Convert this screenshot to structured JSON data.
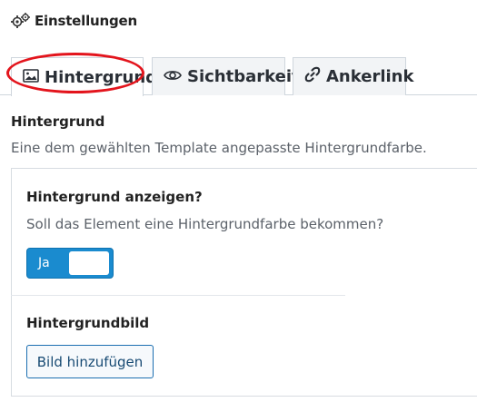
{
  "header": {
    "title": "Einstellungen",
    "icon": "gears-icon"
  },
  "tabs": [
    {
      "label": "Hintergrund",
      "icon": "image-icon",
      "active": true
    },
    {
      "label": "Sichtbarkeit",
      "icon": "eye-icon",
      "active": false
    },
    {
      "label": "Ankerlink",
      "icon": "link-icon",
      "active": false
    }
  ],
  "section": {
    "title": "Hintergrund",
    "description": "Eine dem gewählten Template angepasste Hintergrundfarbe."
  },
  "background_field": {
    "label": "Hintergrund anzeigen?",
    "description": "Soll das Element eine Hintergrundfarbe bekommen?",
    "toggle_label": "Ja",
    "toggle_on": true
  },
  "image_field": {
    "label": "Hintergrundbild",
    "button_label": "Bild hinzufügen"
  },
  "colors": {
    "accent": "#1a8bcf",
    "highlight": "#e3141c"
  }
}
